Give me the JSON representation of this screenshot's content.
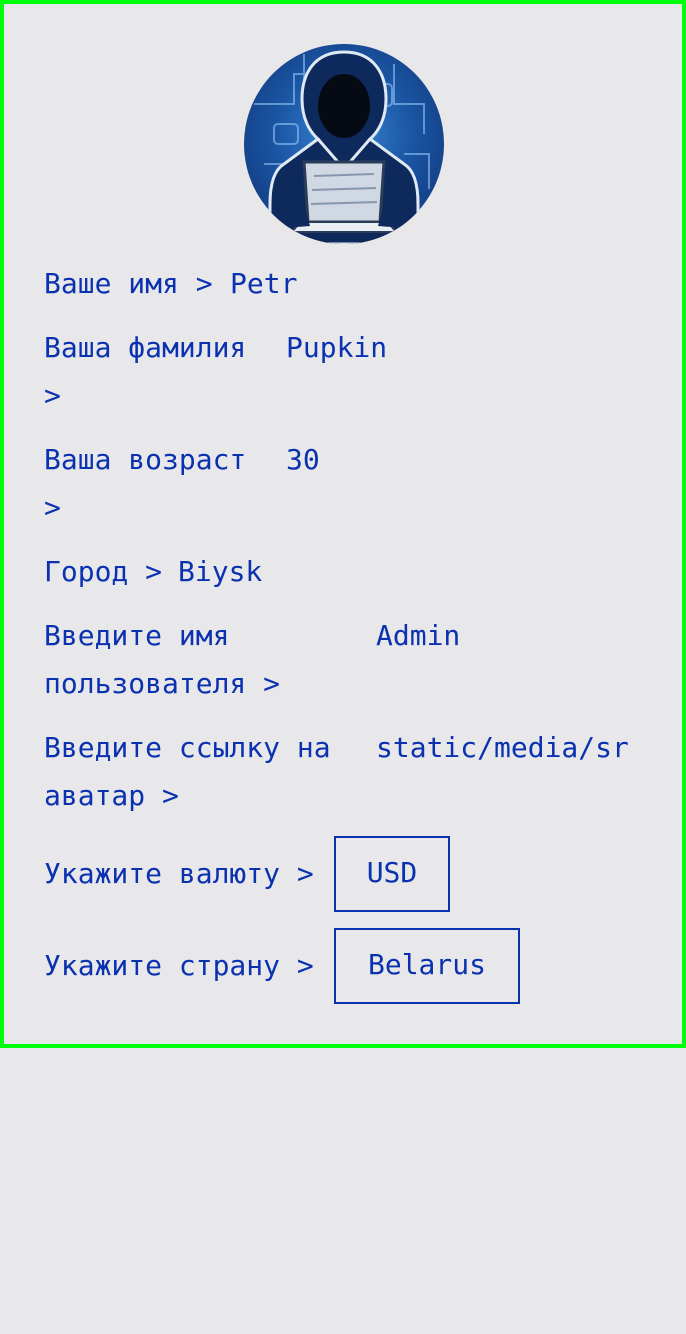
{
  "profile": {
    "avatar_icon": "hacker-avatar-icon",
    "name": {
      "label": "Ваше имя",
      "arrow": ">",
      "value": "Petr"
    },
    "surname": {
      "label": "Ваша фамилия",
      "arrow": ">",
      "value": "Pupkin"
    },
    "age": {
      "label": "Ваша возраст",
      "arrow": ">",
      "value": "30"
    },
    "city": {
      "label": "Город",
      "arrow": ">",
      "value": "Biysk"
    },
    "username": {
      "label_line1": "Введите имя",
      "label_line2": "пользователя",
      "arrow": ">",
      "value": "Admin"
    },
    "avatar_link": {
      "label_line1": "Введите ссылку на",
      "label_line2": "аватар",
      "arrow": ">",
      "value": "static/media/sr"
    },
    "currency": {
      "label": "Укажите валюту",
      "arrow": ">",
      "value": "USD"
    },
    "country": {
      "label": "Укажите страну",
      "arrow": ">",
      "value": "Belarus"
    }
  },
  "colors": {
    "text": "#0a31b0",
    "background": "#e8e7ea",
    "frame": "#00ff0a"
  }
}
